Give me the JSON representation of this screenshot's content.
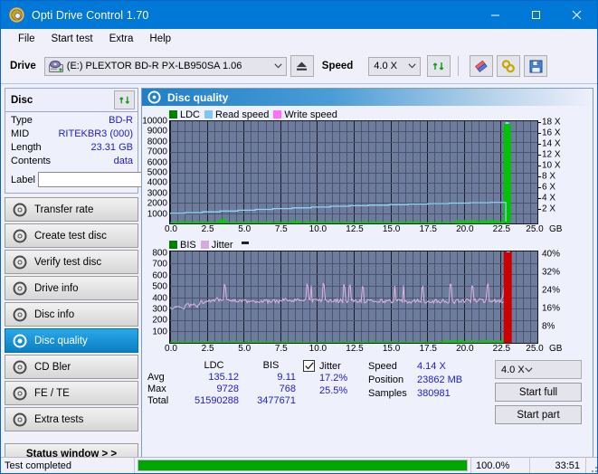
{
  "window": {
    "title": "Opti Drive Control 1.70",
    "icon": "disc-icon",
    "minimize": "minimize-button",
    "maximize": "maximize-button",
    "close": "close-button"
  },
  "menu": {
    "items": [
      "File",
      "Start test",
      "Extra",
      "Help"
    ]
  },
  "toolbar": {
    "drive_label": "Drive",
    "drive_value": "(E:)  PLEXTOR BD-R  PX-LB950SA 1.06",
    "eject_icon": "eject-icon",
    "speed_label": "Speed",
    "speed_value": "4.0 X",
    "refresh_icon": "refresh-icon",
    "erase_icon": "eraser-icon",
    "tools_icon": "tools-icon",
    "save_icon": "save-icon"
  },
  "disc": {
    "header": "Disc",
    "refresh_icon": "refresh-icon",
    "rows": [
      {
        "key": "Type",
        "value": "BD-R"
      },
      {
        "key": "MID",
        "value": "RITEKBR3 (000)"
      },
      {
        "key": "Length",
        "value": "23.31 GB"
      },
      {
        "key": "Contents",
        "value": "data"
      }
    ],
    "label_key": "Label",
    "label_value": "",
    "label_placeholder": "",
    "disc_button_icon": "cd-icon"
  },
  "nav": {
    "items": [
      {
        "label": "Transfer rate",
        "icon": "disc-icon",
        "active": false
      },
      {
        "label": "Create test disc",
        "icon": "disc-icon",
        "active": false
      },
      {
        "label": "Verify test disc",
        "icon": "disc-icon",
        "active": false
      },
      {
        "label": "Drive info",
        "icon": "disc-icon",
        "active": false
      },
      {
        "label": "Disc info",
        "icon": "disc-icon",
        "active": false
      },
      {
        "label": "Disc quality",
        "icon": "disc-icon",
        "active": true
      },
      {
        "label": "CD Bler",
        "icon": "disc-icon",
        "active": false
      },
      {
        "label": "FE / TE",
        "icon": "disc-icon",
        "active": false
      },
      {
        "label": "Extra tests",
        "icon": "disc-icon",
        "active": false
      }
    ],
    "status_window": "Status window > >"
  },
  "panel": {
    "title": "Disc quality",
    "icon": "disc-icon"
  },
  "chart_data": [
    {
      "type": "line",
      "title": "Disc quality - LDC / Read speed",
      "xlabel": "GB",
      "ylabel": "LDC",
      "xlim": [
        0,
        25.0
      ],
      "ylim": [
        0,
        10000
      ],
      "grid": true,
      "legend_position": "top-left",
      "x_ticks": [
        "0.0",
        "2.5",
        "5.0",
        "7.5",
        "10.0",
        "12.5",
        "15.0",
        "17.5",
        "20.0",
        "22.5",
        "25.0"
      ],
      "x_unit": "GB",
      "y_ticks": [
        "10000",
        "9000",
        "8000",
        "7000",
        "6000",
        "5000",
        "4000",
        "3000",
        "2000",
        "1000"
      ],
      "right_axis_label": "X",
      "right_ticks": [
        "18 X",
        "16 X",
        "14 X",
        "12 X",
        "10 X",
        "8 X",
        "6 X",
        "4 X",
        "2 X"
      ],
      "right_lim": [
        0,
        19
      ],
      "series": [
        {
          "name": "LDC",
          "color": "#008000",
          "type": "bar"
        },
        {
          "name": "Read speed",
          "color": "#7ec8f0",
          "type": "line"
        },
        {
          "name": "Write speed",
          "color": "#ff6eff",
          "type": "line"
        }
      ],
      "read_speed_points": [
        [
          0.0,
          1.9
        ],
        [
          1.0,
          2.0
        ],
        [
          2.2,
          2.15
        ],
        [
          3.4,
          2.3
        ],
        [
          4.6,
          2.45
        ],
        [
          5.8,
          2.6
        ],
        [
          7.0,
          2.75
        ],
        [
          8.3,
          2.9
        ],
        [
          9.6,
          3.05
        ],
        [
          10.9,
          3.2
        ],
        [
          12.2,
          3.3
        ],
        [
          13.5,
          3.4
        ],
        [
          14.9,
          3.5
        ],
        [
          16.2,
          3.6
        ],
        [
          17.6,
          3.7
        ],
        [
          19.0,
          3.78
        ],
        [
          20.4,
          3.85
        ],
        [
          21.8,
          3.9
        ],
        [
          22.85,
          3.95
        ]
      ],
      "ldc_spike": {
        "x": 22.95,
        "value": 9728
      }
    },
    {
      "type": "line",
      "title": "Disc quality - BIS / Jitter",
      "xlabel": "GB",
      "ylabel": "BIS",
      "xlim": [
        0,
        25.0
      ],
      "ylim": [
        0,
        800
      ],
      "grid": true,
      "legend_position": "top-left",
      "x_ticks": [
        "0.0",
        "2.5",
        "5.0",
        "7.5",
        "10.0",
        "12.5",
        "15.0",
        "17.5",
        "20.0",
        "22.5",
        "25.0"
      ],
      "x_unit": "GB",
      "y_ticks": [
        "800",
        "700",
        "600",
        "500",
        "400",
        "300",
        "200",
        "100"
      ],
      "right_ticks": [
        "40%",
        "32%",
        "24%",
        "16%",
        "8%"
      ],
      "right_lim": [
        0,
        44
      ],
      "series": [
        {
          "name": "BIS",
          "color": "#008000",
          "type": "bar"
        },
        {
          "name": "Jitter",
          "color": "#d8a8e0",
          "type": "line"
        }
      ],
      "bis_spike": {
        "x": 22.95,
        "value": 768
      },
      "jitter_avg_pct": 17.2,
      "jitter_max_pct": 25.5
    }
  ],
  "stats": {
    "col_headers": [
      "",
      "LDC",
      "BIS"
    ],
    "rows": [
      {
        "label": "Avg",
        "ldc": "135.12",
        "bis": "9.11"
      },
      {
        "label": "Max",
        "ldc": "9728",
        "bis": "768"
      },
      {
        "label": "Total",
        "ldc": "51590288",
        "bis": "3477671"
      }
    ],
    "jitter_label": "Jitter",
    "jitter_checked": true,
    "jitter_avg": "17.2%",
    "jitter_max": "25.5%",
    "speed_label": "Speed",
    "speed_value": "4.14 X",
    "position_label": "Position",
    "position_value": "23862 MB",
    "samples_label": "Samples",
    "samples_value": "380981",
    "speed_select": "4.0 X",
    "start_full": "Start full",
    "start_part": "Start part"
  },
  "statusbar": {
    "message": "Test completed",
    "progress": 100.0,
    "progress_text": "100.0%",
    "elapsed": "33:51"
  },
  "colors": {
    "accent": "#0078d7",
    "plot_bg": "#6d7c9c",
    "ldc_green": "#00c000",
    "bis_red": "#d00000",
    "read_speed": "#7ec8f0",
    "jitter": "#d8a8e0",
    "value_blue": "#2020c8",
    "progress_green": "#00a600"
  }
}
